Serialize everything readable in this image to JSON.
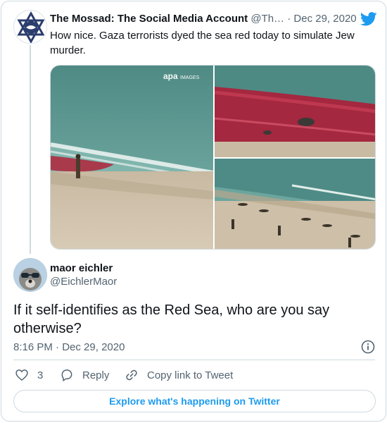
{
  "parent_tweet": {
    "author_name": "The Mossad: The Social Media Account",
    "author_handle": "@Th…",
    "separator": "·",
    "date": "Dec 29, 2020",
    "text": "How nice. Gaza terrorists dyed the sea red today to simulate Jew murder.",
    "watermark": "apa",
    "watermark_sub": "IMAGES",
    "icons": {
      "avatar": "mossad-logo",
      "brand": "twitter-bird-icon"
    }
  },
  "main_tweet": {
    "author_name": "maor eichler",
    "author_handle": "@EichlerMaor",
    "text": "If it self-identifies as the Red Sea, who are you say otherwise?",
    "time": "8:16 PM",
    "separator": "·",
    "date": "Dec 29, 2020"
  },
  "actions": {
    "like_count": "3",
    "reply_label": "Reply",
    "copy_label": "Copy link to Tweet"
  },
  "explore_label": "Explore what's happening on Twitter",
  "colors": {
    "accent": "#1d9bf0",
    "text": "#0f1419",
    "muted": "#536471",
    "border": "#cfd9de"
  }
}
